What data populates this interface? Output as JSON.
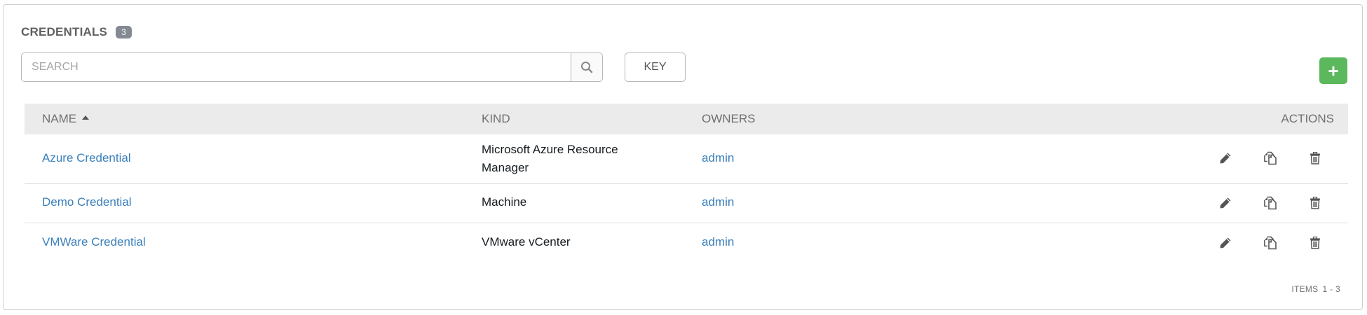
{
  "header": {
    "title": "CREDENTIALS",
    "count": "3"
  },
  "search": {
    "placeholder": "SEARCH"
  },
  "toolbar": {
    "key_label": "KEY",
    "add_label": "+"
  },
  "table": {
    "columns": {
      "name": "NAME",
      "kind": "KIND",
      "owners": "OWNERS",
      "actions": "ACTIONS"
    },
    "rows": [
      {
        "name": "Azure Credential",
        "kind": "Microsoft Azure Resource Manager",
        "owners": "admin"
      },
      {
        "name": "Demo Credential",
        "kind": "Machine",
        "owners": "admin"
      },
      {
        "name": "VMWare Credential",
        "kind": "VMware vCenter",
        "owners": "admin"
      }
    ]
  },
  "footer": {
    "items_label": "ITEMS",
    "items_range": "1 - 3"
  },
  "colors": {
    "link": "#3a7fba",
    "add_button": "#5cb85c",
    "badge": "#848992",
    "header_bg": "#ebebeb"
  },
  "icons": {
    "search": "search-icon",
    "edit": "pencil-icon",
    "copy": "copy-icon",
    "delete": "trash-icon",
    "sort": "sort-ascending-icon"
  }
}
